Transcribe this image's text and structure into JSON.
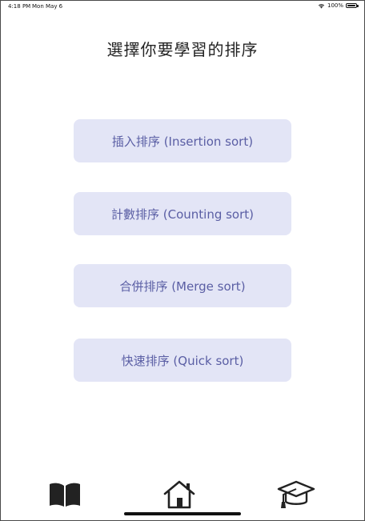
{
  "status_bar": {
    "time": "4:18 PM",
    "date": "Mon May 6",
    "battery": "100%",
    "icons": [
      "wifi-icon",
      "battery-icon"
    ]
  },
  "title": "選擇你要學習的排序",
  "buttons": [
    {
      "label": "插入排序 (Insertion sort)"
    },
    {
      "label": "計數排序 (Counting sort)"
    },
    {
      "label": "合併排序 (Merge sort)"
    },
    {
      "label": "快速排序 (Quick sort)"
    }
  ],
  "tab_bar": {
    "items": [
      {
        "icon": "book-icon"
      },
      {
        "icon": "home-icon"
      },
      {
        "icon": "graduation-cap-icon"
      }
    ]
  },
  "colors": {
    "button_background": "#e3e5f6",
    "button_text": "#5a5ea4",
    "title_text": "#222222"
  }
}
